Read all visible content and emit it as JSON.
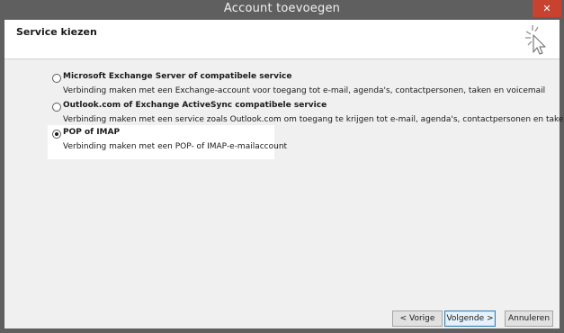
{
  "window": {
    "title": "Account toevoegen",
    "close_icon": "close-icon"
  },
  "header": {
    "title": "Service kiezen",
    "icon": "wizard-cursor-icon"
  },
  "options": [
    {
      "label": "Microsoft Exchange Server of compatibele service",
      "description": "Verbinding maken met een Exchange-account voor toegang tot e-mail, agenda's, contactpersonen, taken en voicemail",
      "selected": false
    },
    {
      "label": "Outlook.com of Exchange ActiveSync compatibele service",
      "description": "Verbinding maken met een service zoals Outlook.com om toegang te krijgen tot e-mail, agenda's, contactpersonen en taken",
      "selected": false
    },
    {
      "label": "POP of IMAP",
      "description": "Verbinding maken met een POP- of IMAP-e-mailaccount",
      "selected": true
    }
  ],
  "footer": {
    "back_label": "< Vorige",
    "next_label": "Volgende >",
    "cancel_label": "Annuleren"
  },
  "colors": {
    "titlebar": "#5f5f5f",
    "close": "#c7432f",
    "client": "#f0f0f0"
  }
}
